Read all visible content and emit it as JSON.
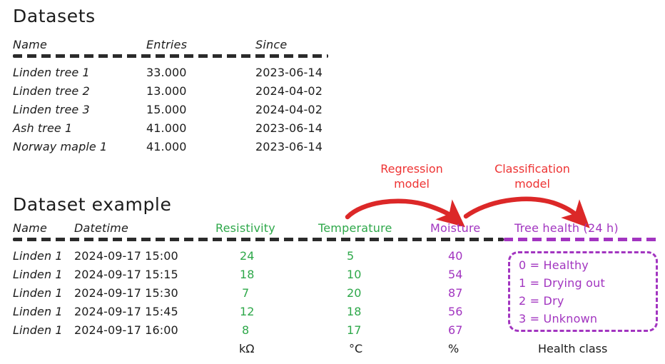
{
  "colors": {
    "ink": "#1c1c1c",
    "green": "#2ea84a",
    "purple": "#a235c0",
    "red": "#ee3333",
    "arrow_red": "#dc2828"
  },
  "datasets_section": {
    "title": "Datasets",
    "columns": [
      "Name",
      "Entries",
      "Since"
    ],
    "rows": [
      {
        "name": "Linden tree 1",
        "entries": "33.000",
        "since": "2023-06-14"
      },
      {
        "name": "Linden tree 2",
        "entries": "13.000",
        "since": "2024-04-02"
      },
      {
        "name": "Linden tree 3",
        "entries": "15.000",
        "since": "2024-04-02"
      },
      {
        "name": "Ash tree 1",
        "entries": "41.000",
        "since": "2023-06-14"
      },
      {
        "name": "Norway maple 1",
        "entries": "41.000",
        "since": "2023-06-14"
      }
    ]
  },
  "annotations": [
    {
      "line1": "Regression",
      "line2": "model"
    },
    {
      "line1": "Classification",
      "line2": "model"
    }
  ],
  "example_section": {
    "title": "Dataset example",
    "columns": [
      "Name",
      "Datetime",
      "Resistivity",
      "Temperature",
      "Moisture",
      "Tree health (24 h)"
    ],
    "rows": [
      {
        "name": "Linden 1",
        "datetime": "2024-09-17 15:00",
        "resistivity": "24",
        "temperature": "5",
        "moisture": "40"
      },
      {
        "name": "Linden 1",
        "datetime": "2024-09-17 15:15",
        "resistivity": "18",
        "temperature": "10",
        "moisture": "54"
      },
      {
        "name": "Linden 1",
        "datetime": "2024-09-17 15:30",
        "resistivity": "7",
        "temperature": "20",
        "moisture": "87"
      },
      {
        "name": "Linden 1",
        "datetime": "2024-09-17 15:45",
        "resistivity": "12",
        "temperature": "18",
        "moisture": "56"
      },
      {
        "name": "Linden 1",
        "datetime": "2024-09-17 16:00",
        "resistivity": "8",
        "temperature": "17",
        "moisture": "67"
      }
    ],
    "units": {
      "resistivity": "kΩ",
      "temperature": "°C",
      "moisture": "%",
      "tree_health": "Health class"
    },
    "health_legend": [
      "0 = Healthy",
      "1 = Drying out",
      "2 = Dry",
      "3 = Unknown"
    ]
  }
}
